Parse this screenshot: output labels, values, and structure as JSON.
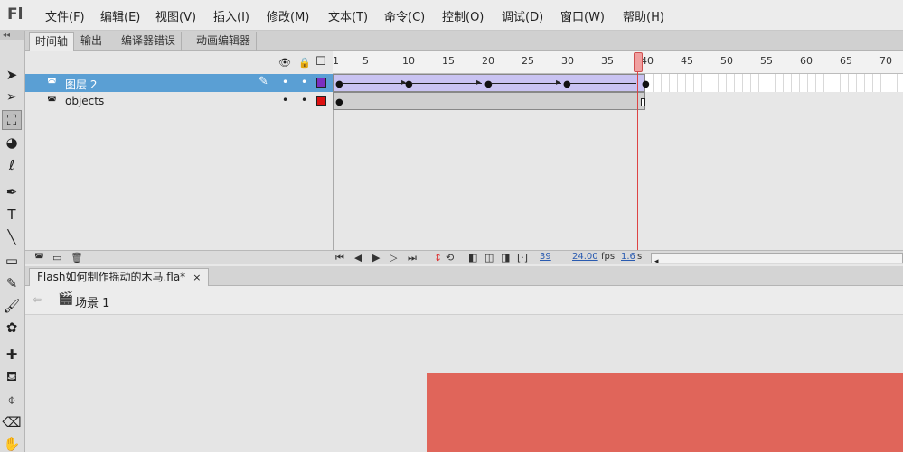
{
  "app": {
    "logo": "Fl"
  },
  "menu": [
    "文件(F)",
    "编辑(E)",
    "视图(V)",
    "插入(I)",
    "修改(M)",
    "文本(T)",
    "命令(C)",
    "控制(O)",
    "调试(D)",
    "窗口(W)",
    "帮助(H)"
  ],
  "panel_tabs": [
    "时间轴",
    "输出",
    "编译器错误",
    "动画编辑器"
  ],
  "toolbar": {
    "collapse": "◂◂"
  },
  "timeline": {
    "ruler_numbers": [
      "1",
      "5",
      "10",
      "15",
      "20",
      "25",
      "30",
      "35",
      "40",
      "45",
      "50",
      "55",
      "60",
      "65",
      "70"
    ],
    "layers": [
      {
        "name": "图层 2",
        "color": "#7b2fbf",
        "selected": true
      },
      {
        "name": "objects",
        "color": "#dd1111",
        "selected": false
      }
    ],
    "current_frame": "39",
    "frame_rate": "24.00",
    "fps_unit": "fps",
    "elapsed": "1.6",
    "elapsed_unit": "s"
  },
  "document": {
    "tab_label": "Flash如何制作摇动的木马.fla*",
    "close": "×"
  },
  "scene": {
    "label": "场景 1"
  },
  "stage": {
    "color": "#e0655a"
  }
}
